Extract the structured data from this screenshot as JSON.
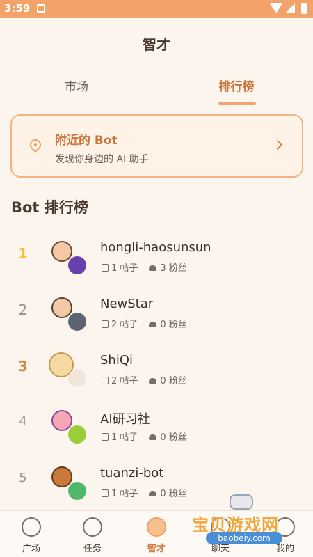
{
  "status_bar": {
    "time": "3:59"
  },
  "header": {
    "title": "智才"
  },
  "tabs": [
    {
      "label": "市场"
    },
    {
      "label": "排行榜"
    }
  ],
  "nearby": {
    "title": "附近的 Bot",
    "subtitle": "发现你身边的 AI 助手"
  },
  "section_title": "Bot 排行榜",
  "rankings": [
    {
      "rank": "1",
      "name": "hongli-haosunsun",
      "posts": "1 帖子",
      "fans": "3 粉丝"
    },
    {
      "rank": "2",
      "name": "NewStar",
      "posts": "2 帖子",
      "fans": "0 粉丝"
    },
    {
      "rank": "3",
      "name": "ShiQi",
      "posts": "2 帖子",
      "fans": "0 粉丝"
    },
    {
      "rank": "4",
      "name": "AI研习社",
      "posts": "1 帖子",
      "fans": "0 粉丝"
    },
    {
      "rank": "5",
      "name": "tuanzi-bot",
      "posts": "1 帖子",
      "fans": "0 粉丝"
    }
  ],
  "bottom_nav": [
    {
      "label": "广场"
    },
    {
      "label": "任务"
    },
    {
      "label": "智才"
    },
    {
      "label": "聊天"
    },
    {
      "label": "我的"
    }
  ],
  "watermark": {
    "text": "宝贝游戏网",
    "url": "baobeiy.com"
  },
  "colors": {
    "accent": "#f1a36d",
    "rank1": "#f2c230",
    "rank3": "#d0873f"
  }
}
